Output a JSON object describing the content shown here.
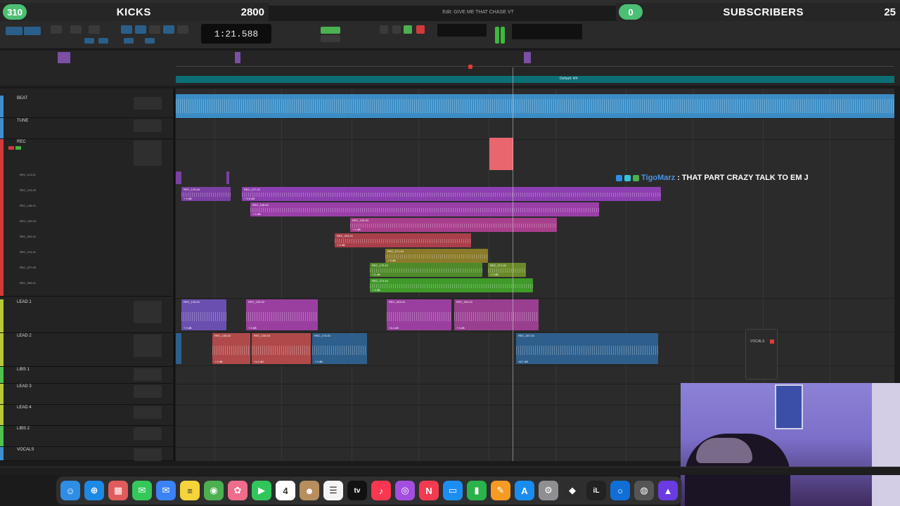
{
  "overlay_left": {
    "count": "310",
    "label": "KICKS",
    "number": "2800"
  },
  "overlay_right": {
    "count": "0",
    "label": "SUBSCRIBERS",
    "number": "25"
  },
  "window_title": "Edit: GIVE ME THAT CHASE VT",
  "counter": "1:21.588",
  "ruler_marker_label": "Default: 4/4",
  "tracks": [
    {
      "name": "BEAT",
      "color": "#3d8fd0"
    },
    {
      "name": "TUNE",
      "color": "#3d8fd0"
    },
    {
      "name": "REC",
      "color": "#d23a3a"
    },
    {
      "name": "LEAD 1",
      "color": "#b7c83a"
    },
    {
      "name": "LEAD 2",
      "color": "#b7c83a"
    },
    {
      "name": "LIBS 1",
      "color": "#4fc24f"
    },
    {
      "name": "LEAD 3",
      "color": "#b7c83a"
    },
    {
      "name": "LEAD 4",
      "color": "#b7c83a"
    },
    {
      "name": "LIBS 2",
      "color": "#4fc24f"
    },
    {
      "name": "VOCALS",
      "color": "#3d8fd0"
    }
  ],
  "rec_sublanes": [
    "REC_113-01",
    "REC_123-03",
    "REC_148-01",
    "REC_159-03",
    "REC_303-01",
    "REC_214-01",
    "REC_227-03",
    "REC_283-01"
  ],
  "clips": [
    {
      "name": "REC_123-04",
      "db": "+ 0 dB"
    },
    {
      "name": "REC_127-01",
      "db": "+ 2.6 dB"
    },
    {
      "name": "REC_148-01",
      "db": "+ 0 dB"
    },
    {
      "name": "REC_159-03",
      "db": "+ 0 dB"
    },
    {
      "name": "REC_303-01",
      "db": "+ 0 dB"
    },
    {
      "name": "REC_271-03",
      "db": "+ 0 dB"
    },
    {
      "name": "REC_175-01",
      "db": "+ 0 dB"
    },
    {
      "name": "REC_271-01",
      "db": "+ 0 dB"
    },
    {
      "name": "REC_274-01",
      "db": "+ 0 dB"
    },
    {
      "name": "REC_133-01",
      "db": "+ 0 dB"
    },
    {
      "name": "REC_153-02",
      "db": "+ 0 dB"
    },
    {
      "name": "REC_303-01",
      "db": "+4.4 dB"
    },
    {
      "name": "REC_304-01",
      "db": "+ 0 dB"
    },
    {
      "name": "REC_108-02",
      "db": "+ 0 dB"
    },
    {
      "name": "REC_106-03",
      "db": "+4.4 dB"
    },
    {
      "name": "REC_174-01",
      "db": "+ 0 dB"
    },
    {
      "name": "REC_307-01",
      "db": "+6.7 dB"
    }
  ],
  "chat": {
    "user": "TigoMarz",
    "message": ": THAT PART CRAZY TALK TO EM J"
  },
  "plugin": {
    "title": "VOCALS"
  },
  "dock_icons": [
    {
      "name": "finder",
      "glyph": "☺",
      "color": "#2f8de4"
    },
    {
      "name": "safari",
      "glyph": "⊕",
      "color": "#1e88e5"
    },
    {
      "name": "launchpad",
      "glyph": "▦",
      "color": "#e05b5b"
    },
    {
      "name": "messages",
      "glyph": "✉",
      "color": "#34c759"
    },
    {
      "name": "mail",
      "glyph": "✉",
      "color": "#3b82f6"
    },
    {
      "name": "notes",
      "glyph": "≡",
      "color": "#f5d33b"
    },
    {
      "name": "maps",
      "glyph": "◉",
      "color": "#4caf50"
    },
    {
      "name": "photos",
      "glyph": "✿",
      "color": "#ef6c8a"
    },
    {
      "name": "facetime",
      "glyph": "▶",
      "color": "#30c65a"
    },
    {
      "name": "calendar",
      "glyph": "4",
      "color": "#ffffff"
    },
    {
      "name": "contacts",
      "glyph": "☻",
      "color": "#b88e5e"
    },
    {
      "name": "reminders",
      "glyph": "☰",
      "color": "#f4f4f4"
    },
    {
      "name": "apple-tv",
      "glyph": "tv",
      "color": "#111111"
    },
    {
      "name": "music",
      "glyph": "♪",
      "color": "#fa3650"
    },
    {
      "name": "podcasts",
      "glyph": "◎",
      "color": "#a44ee0"
    },
    {
      "name": "news",
      "glyph": "N",
      "color": "#f33b4f"
    },
    {
      "name": "keynote",
      "glyph": "▭",
      "color": "#1c8ef2"
    },
    {
      "name": "numbers",
      "glyph": "▮",
      "color": "#29b34a"
    },
    {
      "name": "pages",
      "glyph": "✎",
      "color": "#f59a23"
    },
    {
      "name": "app-store",
      "glyph": "A",
      "color": "#1a8cf0"
    },
    {
      "name": "system-settings",
      "glyph": "⚙",
      "color": "#8e8e93"
    },
    {
      "name": "logic",
      "glyph": "◆",
      "color": "#2e2e2e"
    },
    {
      "name": "ilok",
      "glyph": "iL",
      "color": "#222222"
    },
    {
      "name": "circle-app",
      "glyph": "○",
      "color": "#0f6fd6"
    },
    {
      "name": "plugin-app",
      "glyph": "◍",
      "color": "#555555"
    },
    {
      "name": "pro-tools",
      "glyph": "▲",
      "color": "#6a3be0"
    }
  ]
}
